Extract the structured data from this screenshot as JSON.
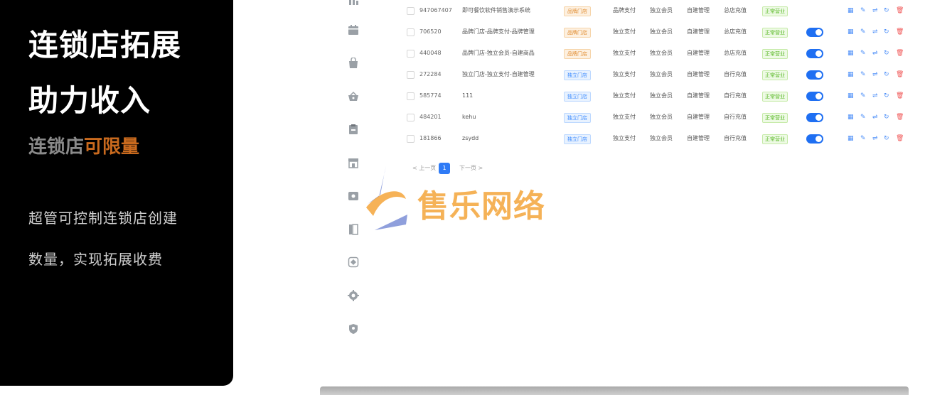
{
  "promo": {
    "title_line1": "连锁店拓展",
    "title_line2": "助力收入",
    "subtitle_prefix": "连锁店",
    "subtitle_accent": "可限量",
    "desc_line1": "超管可控制连锁店创建",
    "desc_line2": "数量，实现拓展收费",
    "colors": {
      "panel": "#000000",
      "accent": "#c96a1e"
    }
  },
  "sidebar_icons": [
    "calendar-icon",
    "shopping-bag-icon",
    "basket-icon",
    "clipboard-icon",
    "store-icon",
    "package-icon",
    "book-icon",
    "plugin-icon",
    "settings-icon",
    "shield-icon"
  ],
  "table": {
    "rows": [
      {
        "id": "947067407",
        "name": "即可餐饮软件销售演示系统",
        "type": "品牌门店",
        "type_kind": "brand",
        "payment": "品牌支付",
        "member": "独立会员",
        "management": "自建管理",
        "recharge": "总店充值",
        "status": "正常营业",
        "enabled": null
      },
      {
        "id": "706520",
        "name": "品牌门店-品牌支付-品牌管理",
        "type": "品牌门店",
        "type_kind": "brand",
        "payment": "独立支付",
        "member": "独立会员",
        "management": "自建管理",
        "recharge": "总店充值",
        "status": "正常营业",
        "enabled": true
      },
      {
        "id": "440048",
        "name": "品牌门店-独立会员-自建商品",
        "type": "品牌门店",
        "type_kind": "brand",
        "payment": "独立支付",
        "member": "独立会员",
        "management": "自建管理",
        "recharge": "总店充值",
        "status": "正常营业",
        "enabled": true
      },
      {
        "id": "272284",
        "name": "独立门店-独立支付-自建管理",
        "type": "独立门店",
        "type_kind": "indep",
        "payment": "独立支付",
        "member": "独立会员",
        "management": "自建管理",
        "recharge": "自行充值",
        "status": "正常营业",
        "enabled": true
      },
      {
        "id": "585774",
        "name": "111",
        "type": "独立门店",
        "type_kind": "indep",
        "payment": "独立支付",
        "member": "独立会员",
        "management": "自建管理",
        "recharge": "自行充值",
        "status": "正常营业",
        "enabled": true
      },
      {
        "id": "484201",
        "name": "kehu",
        "type": "独立门店",
        "type_kind": "indep",
        "payment": "独立支付",
        "member": "独立会员",
        "management": "自建管理",
        "recharge": "自行充值",
        "status": "正常营业",
        "enabled": true
      },
      {
        "id": "181866",
        "name": "zsydd",
        "type": "独立门店",
        "type_kind": "indep",
        "payment": "独立支付",
        "member": "独立会员",
        "management": "自建管理",
        "recharge": "自行充值",
        "status": "正常营业",
        "enabled": true
      }
    ],
    "actions": [
      "qrcode-icon",
      "edit-icon",
      "transfer-icon",
      "refresh-icon",
      "delete-icon"
    ]
  },
  "pagination": {
    "prev_label": "< 上一页",
    "current_page": "1",
    "next_label": "下一页 >"
  },
  "watermark": {
    "text": "售乐网络",
    "color": "#f4a53a"
  }
}
